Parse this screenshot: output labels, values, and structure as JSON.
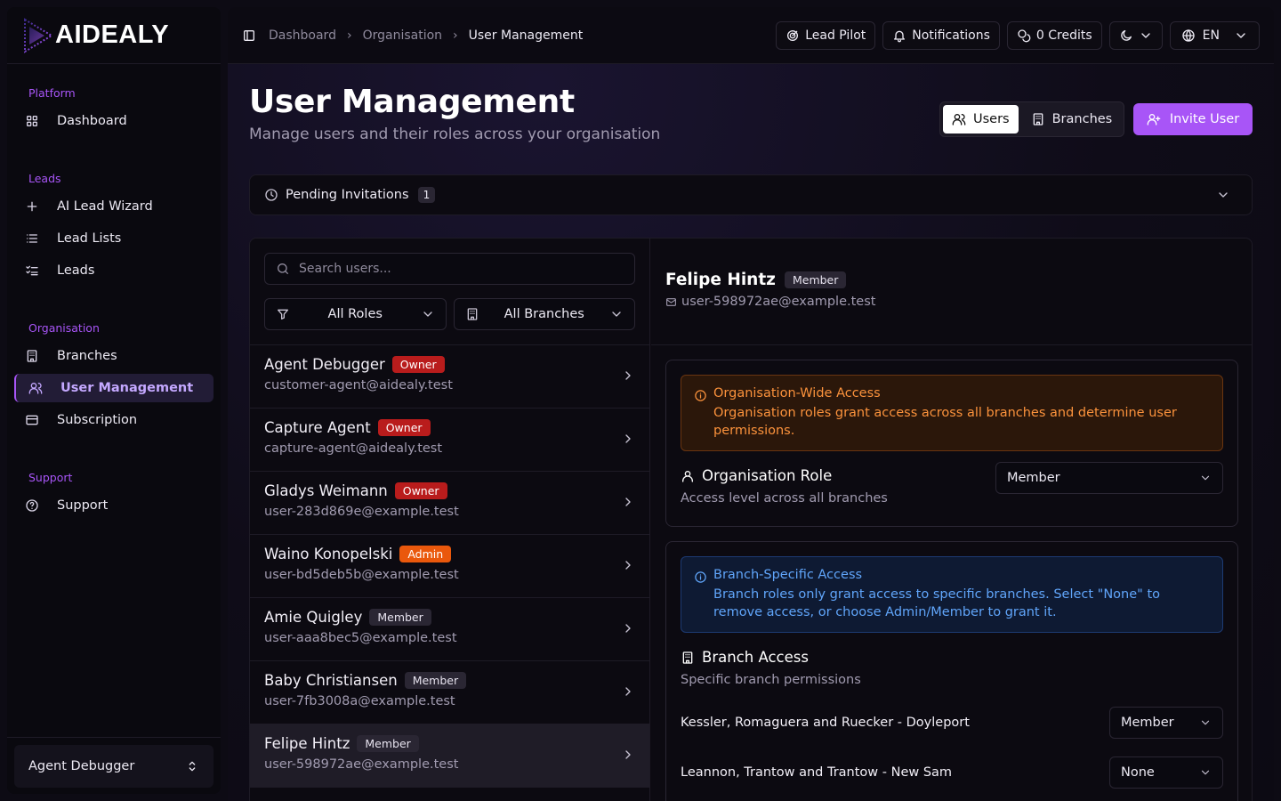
{
  "app": {
    "brand": "AIDEALY"
  },
  "sidebar": {
    "groups": [
      {
        "label": "Platform",
        "items": [
          {
            "label": "Dashboard",
            "icon": "grid-icon"
          }
        ]
      },
      {
        "label": "Leads",
        "items": [
          {
            "label": "AI Lead Wizard",
            "icon": "plus-icon"
          },
          {
            "label": "Lead Lists",
            "icon": "list-icon"
          },
          {
            "label": "Leads",
            "icon": "checklist-icon"
          }
        ]
      },
      {
        "label": "Organisation",
        "items": [
          {
            "label": "Branches",
            "icon": "building-icon"
          },
          {
            "label": "User Management",
            "icon": "users-icon",
            "active": true
          },
          {
            "label": "Subscription",
            "icon": "card-icon"
          }
        ]
      },
      {
        "label": "Support",
        "items": [
          {
            "label": "Support",
            "icon": "help-circle-icon"
          }
        ]
      }
    ],
    "footer_user": "Agent Debugger"
  },
  "topbar": {
    "breadcrumbs": [
      "Dashboard",
      "Organisation",
      "User Management"
    ],
    "lead_pilot": "Lead Pilot",
    "notifications": "Notifications",
    "credits": "0 Credits",
    "language": "EN"
  },
  "page": {
    "title": "User Management",
    "subtitle": "Manage users and their roles across your organisation",
    "tab_users": "Users",
    "tab_branches": "Branches",
    "invite": "Invite User"
  },
  "pending": {
    "label": "Pending Invitations",
    "count": "1"
  },
  "filters": {
    "search_placeholder": "Search users...",
    "roles": "All Roles",
    "branches": "All Branches"
  },
  "users": [
    {
      "name": "Agent Debugger",
      "role": "Owner",
      "email": "customer-agent@aidealy.test"
    },
    {
      "name": "Capture Agent",
      "role": "Owner",
      "email": "capture-agent@aidealy.test"
    },
    {
      "name": "Gladys Weimann",
      "role": "Owner",
      "email": "user-283d869e@example.test"
    },
    {
      "name": "Waino Konopelski",
      "role": "Admin",
      "email": "user-bd5deb5b@example.test"
    },
    {
      "name": "Amie Quigley",
      "role": "Member",
      "email": "user-aaa8bec5@example.test"
    },
    {
      "name": "Baby Christiansen",
      "role": "Member",
      "email": "user-7fb3008a@example.test"
    },
    {
      "name": "Felipe Hintz",
      "role": "Member",
      "email": "user-598972ae@example.test"
    }
  ],
  "detail": {
    "name": "Felipe Hintz",
    "role": "Member",
    "email": "user-598972ae@example.test",
    "org_alert_title": "Organisation-Wide Access",
    "org_alert_body": "Organisation roles grant access across all branches and determine user permissions.",
    "org_role_title": "Organisation Role",
    "org_role_sub": "Access level across all branches",
    "org_role_value": "Member",
    "branch_alert_title": "Branch-Specific Access",
    "branch_alert_body": "Branch roles only grant access to specific branches. Select \"None\" to remove access, or choose Admin/Member to grant it.",
    "branch_title": "Branch Access",
    "branch_sub": "Specific branch permissions",
    "branches": [
      {
        "name": "Kessler, Romaguera and Ruecker - Doyleport",
        "role": "Member"
      },
      {
        "name": "Leannon, Trantow and Trantow - New Sam",
        "role": "None"
      }
    ]
  },
  "colors": {
    "accent": "#a855f7",
    "owner": "#b91c1c",
    "admin": "#ea580c",
    "info": "#60a5fa",
    "warning": "#fb923c"
  }
}
